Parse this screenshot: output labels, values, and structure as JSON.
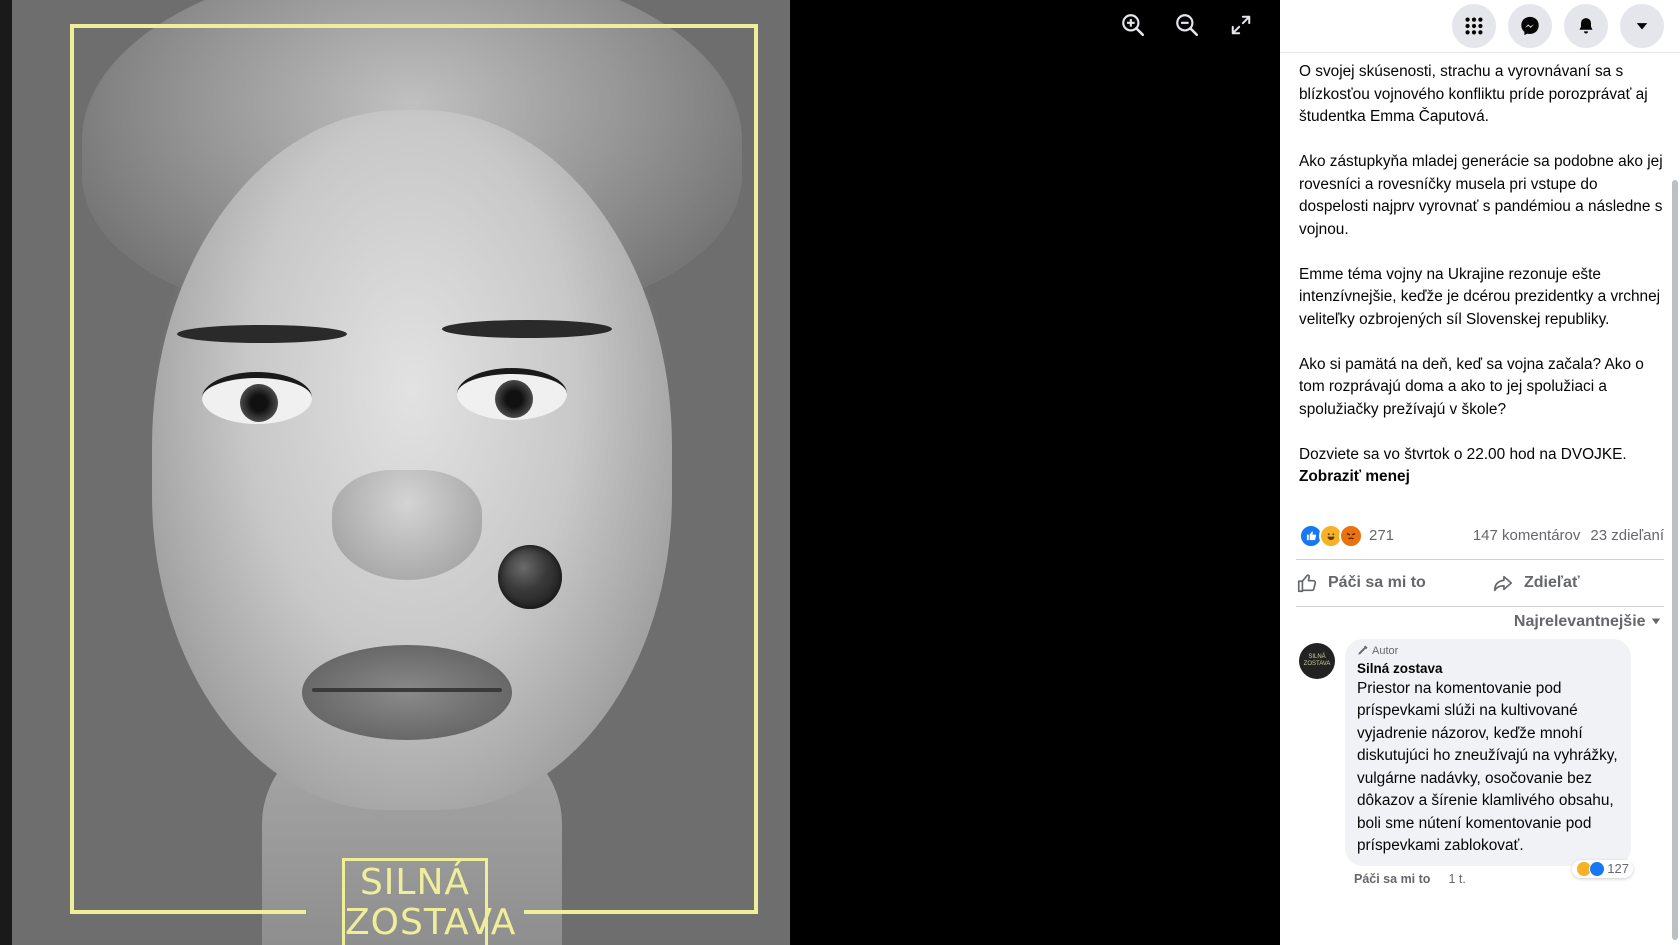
{
  "viewer": {
    "tools": [
      "zoom-in-icon",
      "zoom-out-icon",
      "fullscreen-icon"
    ],
    "logo_line1": "SILNÁ",
    "logo_line2": "ZOSTAVA"
  },
  "topbar": {
    "buttons": [
      "apps-grid-icon",
      "messenger-icon",
      "bell-icon",
      "chevron-down-icon"
    ]
  },
  "post": {
    "paragraphs": [
      "O svojej skúsenosti, strachu a vyrovnávaní sa s blízkosťou vojnového konfliktu príde porozprávať aj študentka Emma Čaputová.",
      "Ako zástupkyňa mladej generácie sa podobne ako jej rovesníci a rovesníčky musela pri vstupe do dospelosti najprv vyrovnať s pandémiou a následne s vojnou.",
      "Emme téma vojny na Ukrajine rezonuje ešte intenzívnejšie, keďže je dcérou prezidentky a vrchnej veliteľky ozbrojených síl Slovenskej republiky.",
      "Ako si pamätá na deň, keď sa vojna začala? Ako o tom rozprávajú doma a ako to jej spolužiaci a spolužiačky prežívajú v škole?"
    ],
    "last_line": "Dozviete sa vo štvrtok o 22.00 hod na DVOJKE.",
    "see_less": "Zobraziť menej",
    "reaction_count": "271",
    "comments_count": "147 komentárov",
    "shares_count": "23 zdieľaní",
    "like_label": "Páči sa mi to",
    "share_label": "Zdieľať",
    "sort_label": "Najrelevantnejšie"
  },
  "comment": {
    "avatar_text": "SILNÁ ZOSTAVA",
    "badge": "Autor",
    "name": "Silná zostava",
    "text": "Priestor na komentovanie pod príspevkami slúži na kultivované vyjadrenie názorov, keďže mnohí diskutujúci ho zneužívajú na vyhrážky, vulgárne nadávky, osočovanie bez dôkazov a šírenie klamlivého obsahu, boli sme nútení komentovanie pod príspevkami zablokovať.",
    "reaction_count": "127",
    "like_label": "Páči sa mi to",
    "time": "1 t."
  },
  "colors": {
    "frame": "#efef9a",
    "like_blue": "#1877f2",
    "haha_yellow": "#f7b125",
    "angry_orange": "#e9710f"
  }
}
